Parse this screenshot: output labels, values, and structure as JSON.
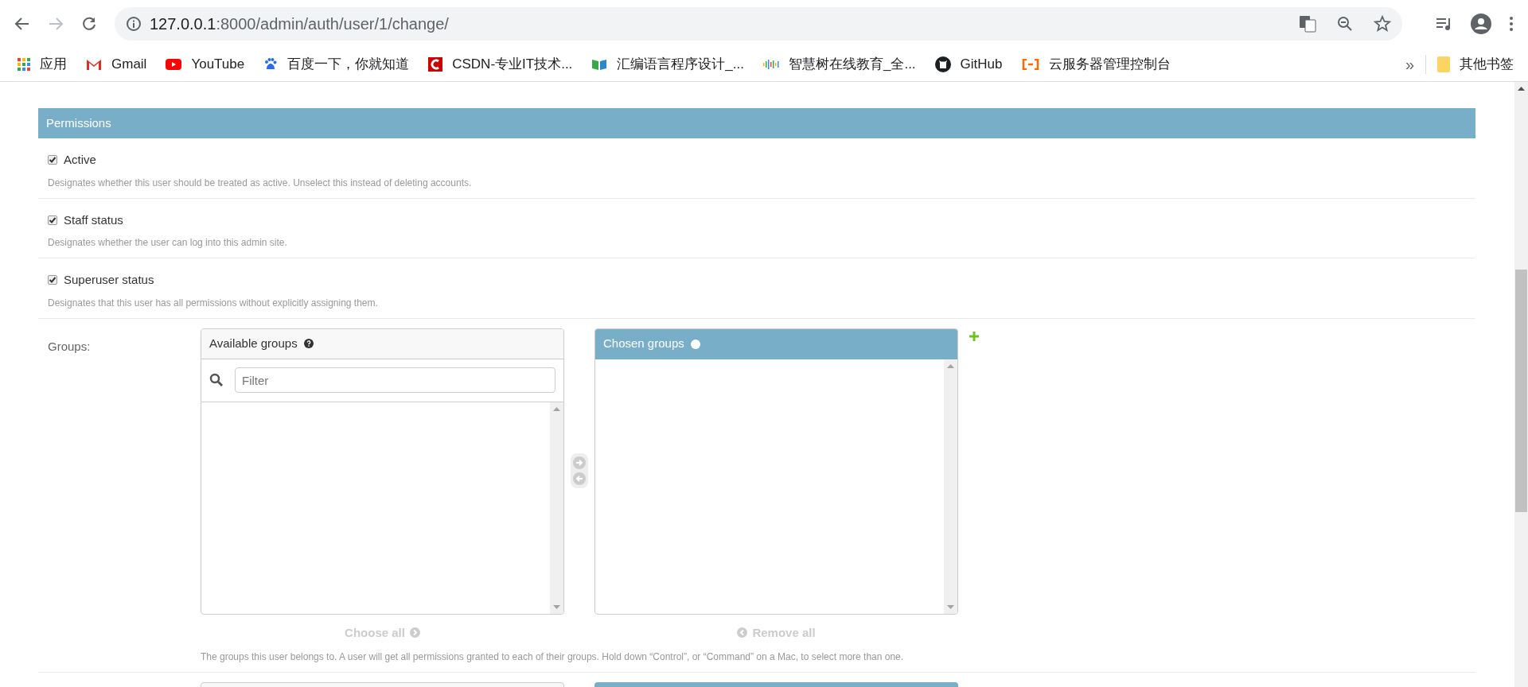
{
  "browser": {
    "url_host": "127.0.0.1",
    "url_path": ":8000/admin/auth/user/1/change/",
    "bookmarks": [
      {
        "kind": "apps",
        "label": "应用"
      },
      {
        "kind": "gmail",
        "label": "Gmail"
      },
      {
        "kind": "youtube",
        "label": "YouTube"
      },
      {
        "kind": "baidu",
        "label": "百度一下，你就知道"
      },
      {
        "kind": "csdn",
        "label": "CSDN-专业IT技术..."
      },
      {
        "kind": "book",
        "label": "汇编语言程序设计_..."
      },
      {
        "kind": "bars",
        "label": "智慧树在线教育_全..."
      },
      {
        "kind": "github",
        "label": "GitHub"
      },
      {
        "kind": "cloud",
        "label": "云服务器管理控制台"
      }
    ],
    "overflow": "»",
    "other_bookmarks": "其他书签"
  },
  "permissions": {
    "title": "Permissions",
    "checkboxes": [
      {
        "label": "Active",
        "help": "Designates whether this user should be treated as active. Unselect this instead of deleting accounts.",
        "checked": true
      },
      {
        "label": "Staff status",
        "help": "Designates whether the user can log into this admin site.",
        "checked": true
      },
      {
        "label": "Superuser status",
        "help": "Designates that this user has all permissions without explicitly assigning them.",
        "checked": true
      }
    ]
  },
  "groups": {
    "label": "Groups:",
    "available_title": "Available groups",
    "filter_placeholder": "Filter",
    "chosen_title": "Chosen groups",
    "choose_all": "Choose all",
    "remove_all": "Remove all",
    "help": "The groups this user belongs to. A user will get all permissions granted to each of their groups. Hold down “Control”, or “Command” on a Mac, to select more than one."
  }
}
